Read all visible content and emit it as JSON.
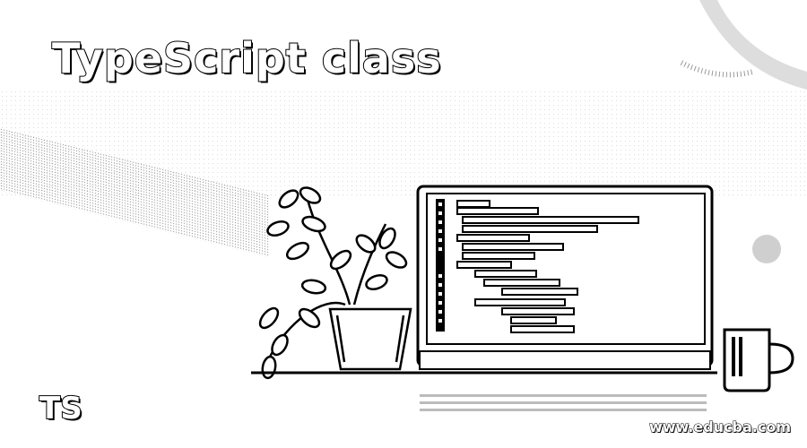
{
  "banner": {
    "title": "TypeScript class",
    "badge": "TS",
    "website": "www.educba.com"
  },
  "illustration": {
    "laptop": "laptop-icon",
    "plant": "potted-plant-icon",
    "mug": "mug-icon"
  }
}
